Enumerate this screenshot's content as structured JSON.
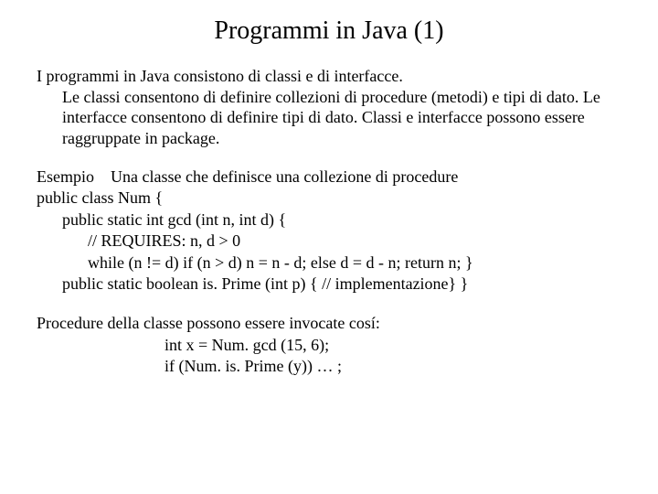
{
  "title": "Programmi in Java (1)",
  "intro_line": "I programmi in Java consistono di classi e di interfacce.",
  "intro_body": "Le classi consentono di definire collezioni di procedure (metodi) e tipi di dato. Le interfacce consentono di definire tipi di dato. Classi e interfacce possono essere raggruppate in package.",
  "example_label": "Esempio",
  "example_caption": "Una classe che definisce  una collezione di procedure",
  "code": {
    "l1": "public class Num {",
    "l2": "public static int gcd (int n, int d) {",
    "l3": "// REQUIRES: n, d > 0",
    "l4": "while (n != d) if (n > d) n = n - d; else d = d - n; return n; }",
    "l5": "public static boolean is. Prime (int p) { // implementazione}   }"
  },
  "invoke_intro": "Procedure della classe possono essere invocate cosí:",
  "invoke1": "int x = Num. gcd (15, 6);",
  "invoke2": " if (Num. is. Prime (y)) … ;"
}
